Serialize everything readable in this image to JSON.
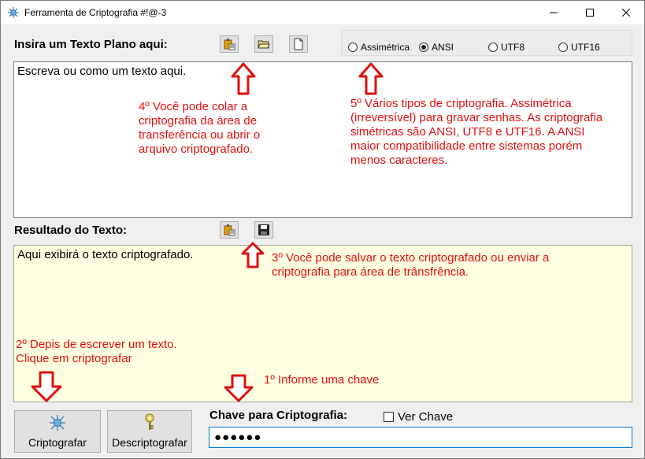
{
  "window": {
    "title": "Ferramenta de Criptografia  #!@-3"
  },
  "input_section": {
    "label": "Insira um Texto Plano aqui:",
    "text": "Escreva ou como um texto aqui.",
    "buttons": [
      "paste-icon",
      "open-folder-icon",
      "new-document-icon"
    ]
  },
  "encoding": {
    "options": [
      {
        "label": "Assimétrica",
        "checked": false
      },
      {
        "label": "ANSI",
        "checked": true
      },
      {
        "label": "UTF8",
        "checked": false
      },
      {
        "label": "UTF16",
        "checked": false
      }
    ]
  },
  "result_section": {
    "label": "Resultado do Texto:",
    "text": "Aqui exibirá o texto criptografado.",
    "buttons": [
      "paste-icon",
      "save-icon"
    ]
  },
  "notes": {
    "note4": [
      "4º Você pode colar a",
      "criptografia da área de",
      "transferência ou abrir o",
      "arquivo criptografado."
    ],
    "note5": [
      "5º Vários tipos de criptografia. Assimétrica",
      "(irreversível) para gravar senhas. As criptografia",
      "simétricas são ANSI, UTF8 e UTF16. A ANSI",
      "maior compatibilidade entre sistemas porém",
      "menos caracteres."
    ],
    "note3": [
      "3º Você pode salvar o texto criptografado ou enviar a",
      "criptografia para área de trânsfrência."
    ],
    "note2": [
      "2º Depis de escrever um texto.",
      "Clique em criptografar"
    ],
    "note1": "1º Informe uma chave"
  },
  "actions": {
    "encrypt_label": "Criptografar",
    "decrypt_label": "Descriptografar"
  },
  "key": {
    "label": "Chave para Criptografia:",
    "show_key_label": "Ver Chave",
    "show_key_checked": false,
    "value": "●●●●●●"
  },
  "colors": {
    "annotation": "#e01010",
    "result_bg": "#ffffe1",
    "key_border": "#0078d7"
  }
}
